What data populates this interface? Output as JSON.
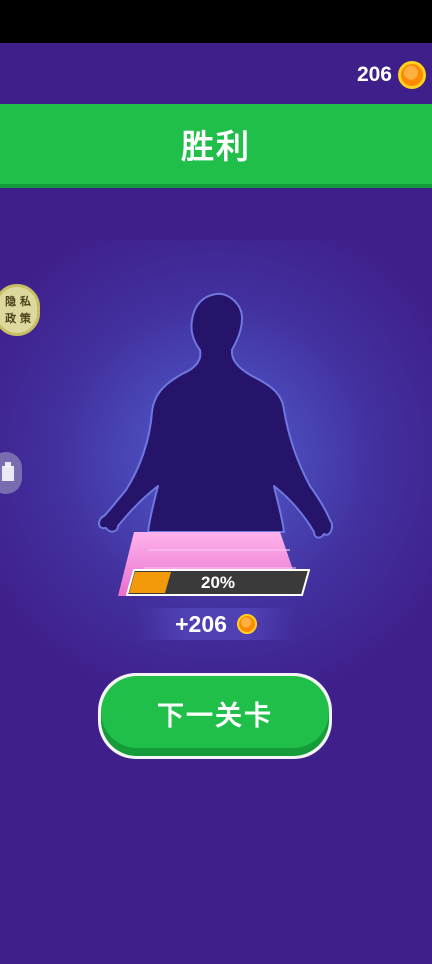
{
  "header": {
    "coins": "206"
  },
  "banner": {
    "title": "胜利"
  },
  "side": {
    "privacy_label_line1": "隐 私",
    "privacy_label_line2": "政 策"
  },
  "progress": {
    "value": 0.2,
    "label": "20%"
  },
  "reward": {
    "text": "+206"
  },
  "actions": {
    "next_level": "下一关卡"
  },
  "colors": {
    "background": "#3f1f8a",
    "banner": "#1fbf4a",
    "button": "#1fbf4a",
    "progress_fill": "#f39a0b",
    "progress_track": "#3a3a3a",
    "skirt_fill": "#f08bd8",
    "silhouette": "#26136a",
    "coin": "#ff8a00"
  },
  "icons": [
    "coin-icon",
    "dress-silhouette",
    "privacy-badge",
    "side-button-icon"
  ]
}
